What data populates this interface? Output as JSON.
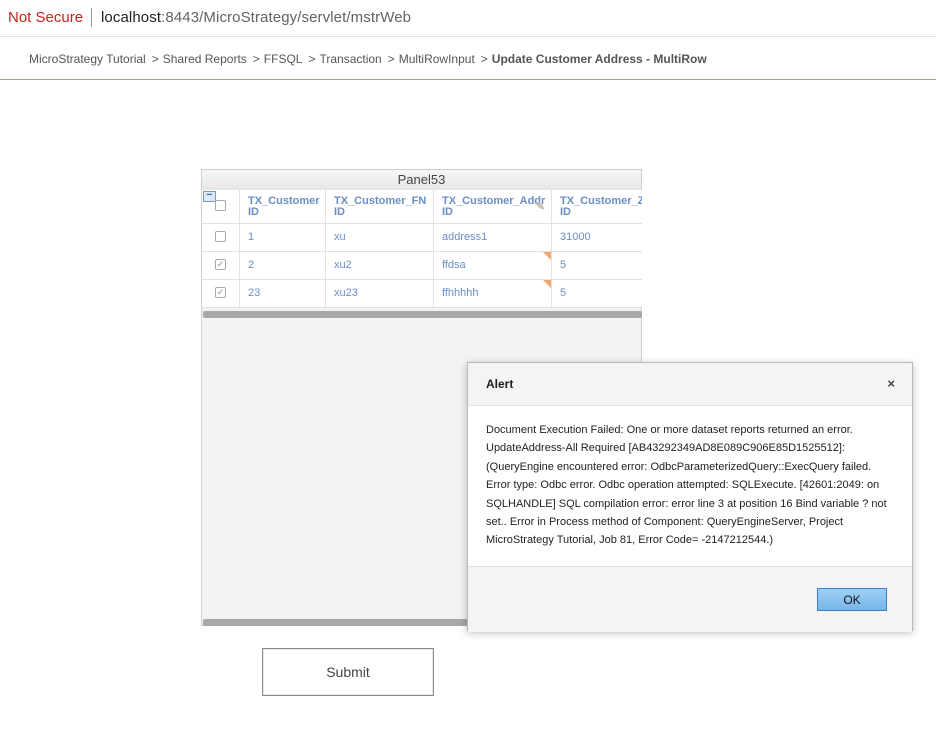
{
  "browser": {
    "security_label": "Not Secure",
    "url_host": "localhost",
    "url_path": ":8443/MicroStrategy/servlet/mstrWeb"
  },
  "breadcrumb": {
    "items": [
      "MicroStrategy Tutorial",
      "Shared Reports",
      "FFSQL",
      "Transaction",
      "MultiRowInput"
    ],
    "separator": ">",
    "current": "Update Customer Address - MultiRow"
  },
  "panel": {
    "title": "Panel53",
    "collapse_symbol": "−",
    "columns": [
      {
        "line1": "TX_Customer",
        "line2": "ID"
      },
      {
        "line1": "TX_Customer_FN",
        "line2": "ID"
      },
      {
        "line1": "TX_Customer_Addr",
        "line2": "ID"
      },
      {
        "line1": "TX_Customer_Z",
        "line2": "ID"
      }
    ],
    "rows": [
      {
        "checked": false,
        "id": "1",
        "fn": "xu",
        "addr": "address1",
        "zip": "31000",
        "edited": false
      },
      {
        "checked": true,
        "id": "2",
        "fn": "xu2",
        "addr": "ffdsa",
        "zip": "5",
        "edited": true
      },
      {
        "checked": true,
        "id": "23",
        "fn": "xu23",
        "addr": "ffhhhhh",
        "zip": "5",
        "edited": true
      }
    ],
    "edit_icon": "pencil-icon",
    "edited_marker_color": "#f5a46b"
  },
  "submit": {
    "label": "Submit"
  },
  "alert": {
    "title": "Alert",
    "close_symbol": "×",
    "lines": [
      "Document Execution Failed: One or more dataset reports returned an error.",
      "UpdateAddress-All Required [AB43292349AD8E089C906E85D1525512]:",
      "(QueryEngine encountered error: OdbcParameterizedQuery::ExecQuery failed.",
      "Error type: Odbc error. Odbc operation attempted: SQLExecute. [42601:2049: on",
      "SQLHANDLE] SQL compilation error: error line 3 at position 16 Bind variable ? not",
      "set.. Error in Process method of Component: QueryEngineServer, Project",
      "MicroStrategy Tutorial, Job 81, Error Code= -2147212544.)"
    ],
    "ok_label": "OK"
  },
  "colors": {
    "not_secure": "#c8231e",
    "grid_text": "#6b8ec5",
    "breadcrumb_border": "#e8827a",
    "ok_button": "#77b6ea"
  }
}
